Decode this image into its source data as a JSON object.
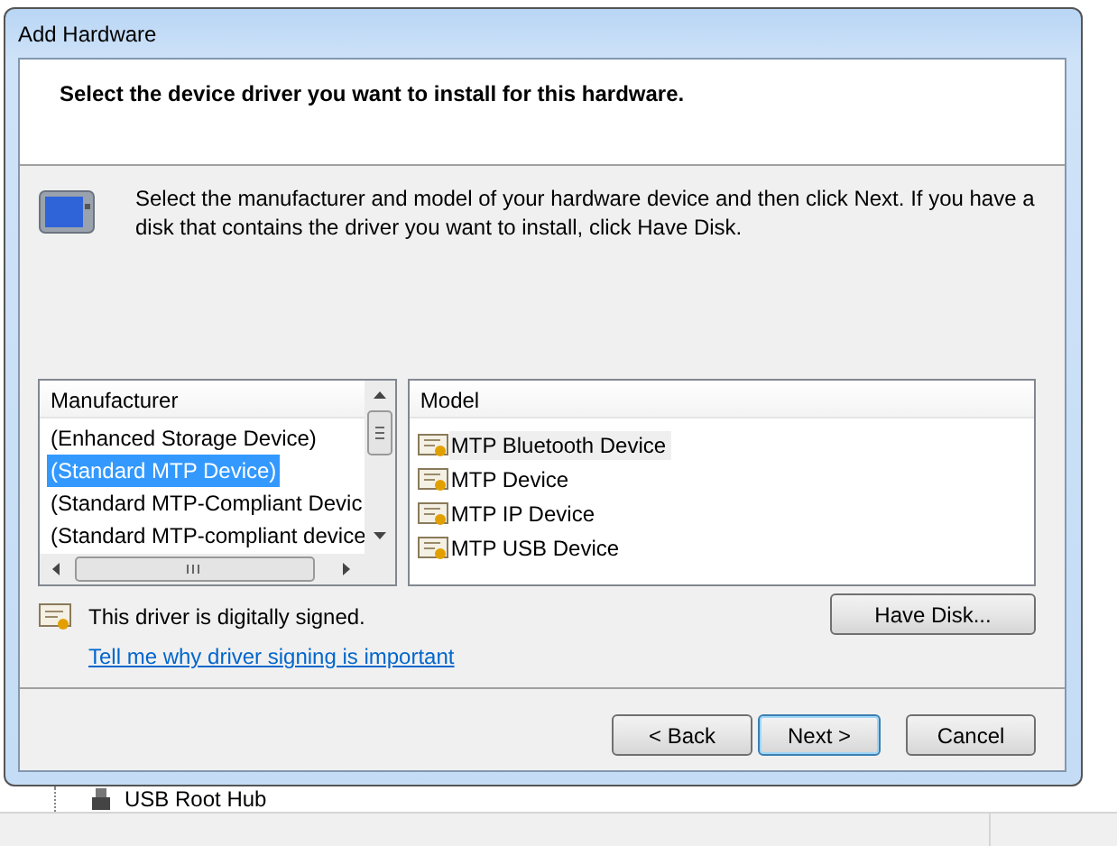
{
  "window": {
    "title": "Add Hardware"
  },
  "header": {
    "title": "Select the device driver you want to install for this hardware."
  },
  "description": "Select the manufacturer and model of your hardware device and then click Next. If you have a disk that contains the driver you want to install, click Have Disk.",
  "manufacturer_list": {
    "heading": "Manufacturer",
    "items": [
      {
        "label": "(Enhanced Storage Device)",
        "selected": false
      },
      {
        "label": "(Standard MTP Device)",
        "selected": true
      },
      {
        "label": "(Standard MTP-Compliant Devic",
        "selected": false
      },
      {
        "label": "(Standard MTP-compliant device",
        "selected": false
      }
    ]
  },
  "model_list": {
    "heading": "Model",
    "items": [
      {
        "label": "MTP Bluetooth Device",
        "selected": true
      },
      {
        "label": "MTP Device",
        "selected": false
      },
      {
        "label": "MTP IP Device",
        "selected": false
      },
      {
        "label": "MTP USB Device",
        "selected": false
      }
    ]
  },
  "signature": {
    "text": "This driver is digitally signed.",
    "link": "Tell me why driver signing is important"
  },
  "have_disk_button": "Have Disk...",
  "buttons": [
    {
      "label": "< Back",
      "default": false
    },
    {
      "label": "Next >",
      "default": true
    },
    {
      "label": "Cancel",
      "default": false
    }
  ],
  "background": {
    "tree_item": "USB Root Hub"
  }
}
